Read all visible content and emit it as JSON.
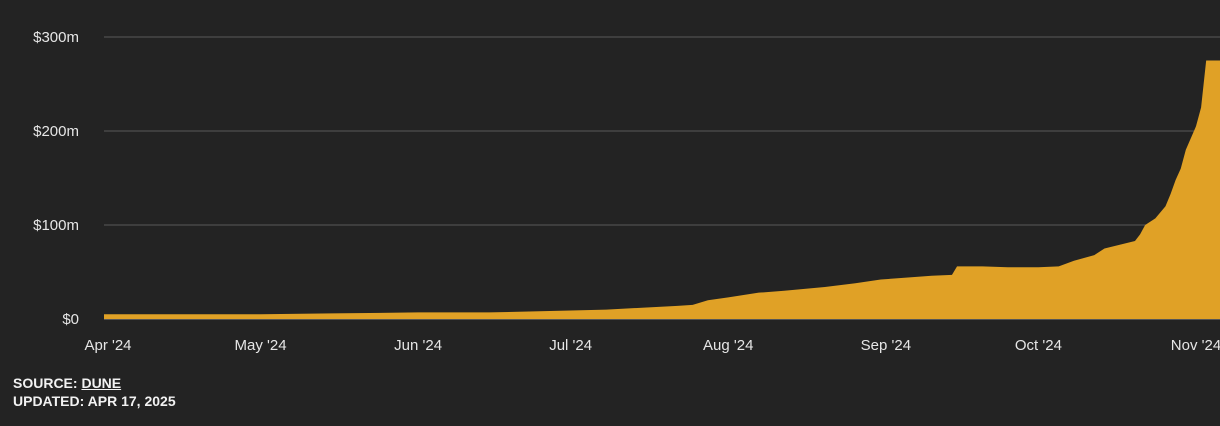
{
  "chart_data": {
    "type": "area",
    "title": "",
    "xlabel": "",
    "ylabel": "",
    "y_unit": "$m",
    "ylim": [
      0,
      300
    ],
    "grid": true,
    "y_ticks": [
      {
        "value": 0,
        "label": "$0"
      },
      {
        "value": 100,
        "label": "$100m"
      },
      {
        "value": 200,
        "label": "$200m"
      },
      {
        "value": 300,
        "label": "$300m"
      }
    ],
    "x_ticks": [
      {
        "date": "2024-04-01",
        "label": "Apr '24"
      },
      {
        "date": "2024-05-01",
        "label": "May '24"
      },
      {
        "date": "2024-06-01",
        "label": "Jun '24"
      },
      {
        "date": "2024-07-01",
        "label": "Jul '24"
      },
      {
        "date": "2024-08-01",
        "label": "Aug '24"
      },
      {
        "date": "2024-09-01",
        "label": "Sep '24"
      },
      {
        "date": "2024-10-01",
        "label": "Oct '24"
      },
      {
        "date": "2024-11-01",
        "label": "Nov '24"
      }
    ],
    "series": [
      {
        "color": "#e0a126",
        "points": [
          [
            "2024-04-01",
            5
          ],
          [
            "2024-04-15",
            5
          ],
          [
            "2024-05-01",
            5
          ],
          [
            "2024-05-15",
            6
          ],
          [
            "2024-06-01",
            7
          ],
          [
            "2024-06-15",
            7
          ],
          [
            "2024-07-01",
            9
          ],
          [
            "2024-07-08",
            10
          ],
          [
            "2024-07-15",
            12
          ],
          [
            "2024-07-22",
            14
          ],
          [
            "2024-07-25",
            15
          ],
          [
            "2024-07-28",
            20
          ],
          [
            "2024-08-01",
            23
          ],
          [
            "2024-08-07",
            28
          ],
          [
            "2024-08-12",
            30
          ],
          [
            "2024-08-20",
            34
          ],
          [
            "2024-08-26",
            38
          ],
          [
            "2024-08-31",
            42
          ],
          [
            "2024-09-05",
            44
          ],
          [
            "2024-09-10",
            46
          ],
          [
            "2024-09-14",
            47
          ],
          [
            "2024-09-15",
            56
          ],
          [
            "2024-09-20",
            56
          ],
          [
            "2024-09-25",
            55
          ],
          [
            "2024-10-01",
            55
          ],
          [
            "2024-10-05",
            56
          ],
          [
            "2024-10-08",
            62
          ],
          [
            "2024-10-12",
            68
          ],
          [
            "2024-10-14",
            75
          ],
          [
            "2024-10-17",
            79
          ],
          [
            "2024-10-20",
            83
          ],
          [
            "2024-10-21",
            90
          ],
          [
            "2024-10-22",
            100
          ],
          [
            "2024-10-24",
            107
          ],
          [
            "2024-10-26",
            120
          ],
          [
            "2024-10-27",
            133
          ],
          [
            "2024-10-28",
            148
          ],
          [
            "2024-10-29",
            160
          ],
          [
            "2024-10-30",
            180
          ],
          [
            "2024-11-01",
            205
          ],
          [
            "2024-11-02",
            225
          ],
          [
            "2024-11-03",
            275
          ]
        ]
      }
    ]
  },
  "footer": {
    "source_prefix": "SOURCE: ",
    "source_link": "DUNE",
    "updated": "UPDATED: APR 17, 2025"
  }
}
